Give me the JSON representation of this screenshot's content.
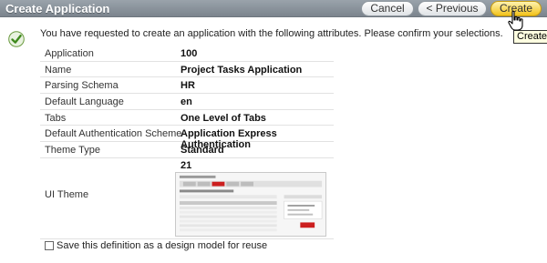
{
  "header": {
    "title": "Create Application",
    "buttons": {
      "cancel": "Cancel",
      "previous": "< Previous",
      "create": "Create"
    },
    "tooltip": "Create"
  },
  "intro": "You have requested to create an application with the following attributes. Please confirm your selections.",
  "attributes": [
    {
      "label": "Application",
      "value": "100"
    },
    {
      "label": "Name",
      "value": "Project Tasks Application"
    },
    {
      "label": "Parsing Schema",
      "value": "HR"
    },
    {
      "label": "Default Language",
      "value": "en"
    },
    {
      "label": "Tabs",
      "value": "One Level of Tabs"
    },
    {
      "label": "Default Authentication Scheme",
      "value": "Application Express Authentication"
    },
    {
      "label": "Theme Type",
      "value": "Standard"
    },
    {
      "label": "UI Theme",
      "value": "21"
    }
  ],
  "save_model": {
    "label": "Save this definition as a design model for reuse",
    "checked": false
  },
  "colors": {
    "header": "#8a939b",
    "create_button": "#f2c21a",
    "check_icon": "#5a9a2a"
  }
}
